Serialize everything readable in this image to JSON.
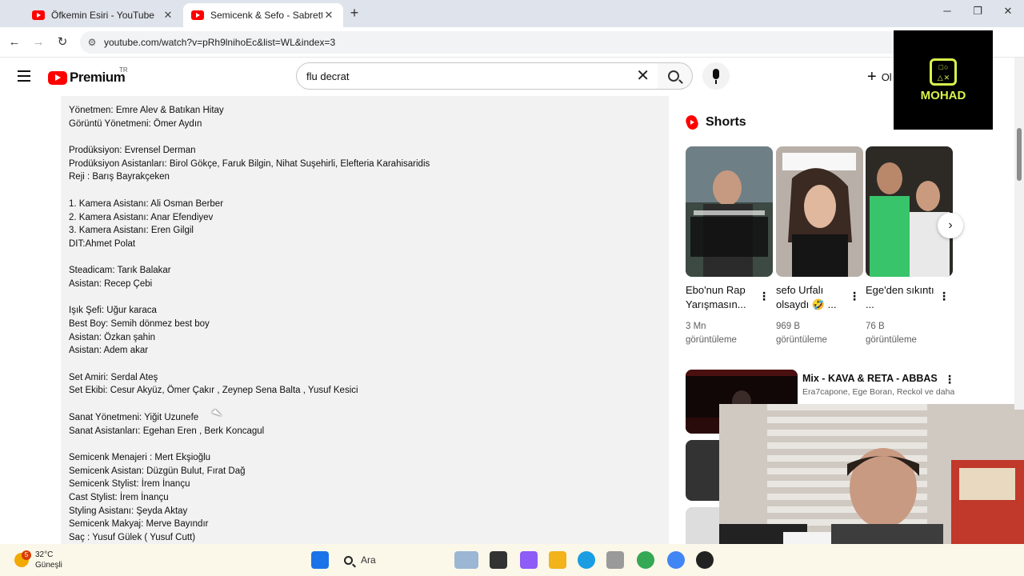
{
  "browser": {
    "tabs": [
      {
        "title": "Öfkemin Esiri - YouTube",
        "active": false
      },
      {
        "title": "Semicenk & Sefo - Sabrettim (p",
        "active": true
      }
    ],
    "url": "youtube.com/watch?v=pRh9lnihoEc&list=WL&index=3"
  },
  "youtube": {
    "logo_text": "Premium",
    "country": "TR",
    "search_value": "flu decrat",
    "create_label": "Ol"
  },
  "overlay": {
    "brand": "MOHAD"
  },
  "description_lines": [
    "Yönetmen: Emre Alev & Batıkan Hitay",
    "Görüntü Yönetmeni: Ömer Aydın",
    "",
    "Prodüksiyon: Evrensel Derman",
    "Prodüksiyon Asistanları: Birol Gökçe, Faruk Bilgin, Nihat Suşehirli, Elefteria Karahisaridis",
    "Reji : Barış Bayrakçeken",
    "",
    "1. Kamera Asistanı: Ali Osman Berber",
    "2. Kamera Asistanı: Anar Efendiyev",
    "3. Kamera Asistanı: Eren Gilgil",
    "DIT:Ahmet Polat",
    "",
    "Steadicam: Tarık Balakar",
    "Asistan: Recep Çebi",
    "",
    "Işık Şefi: Uğur karaca",
    "Best Boy: Semih dönmez best boy",
    "Asistan: Özkan şahin",
    "Asistan: Adem akar",
    "",
    "Set Amiri: Serdal Ateş",
    "Set Ekibi: Cesur Akyüz, Ömer Çakır , Zeynep Sena Balta , Yusuf Kesici",
    "",
    "Sanat Yönetmeni: Yiğit Uzunefe",
    "Sanat Asistanları: Egehan Eren , Berk Koncagul",
    "",
    "Semicenk Menajeri : Mert Ekşioğlu",
    "Semicenk Asistan: Düzgün Bulut, Fırat Dağ",
    "Semicenk Stylist: İrem İnançu",
    "Cast Stylist: İrem İnançu",
    "Styling Asistanı: Şeyda  Aktay",
    "Semicenk Makyaj: Merve Bayındır",
    "Saç : Yusuf Gülek ( Yusuf Cutt)"
  ],
  "shorts": {
    "heading": "Shorts",
    "items": [
      {
        "title": "Ebo'nun Rap Yarışmasın...",
        "views": "3 Mn",
        "views_label": "görüntüleme"
      },
      {
        "title": "sefo Urfalı olsaydı 🤣 ...",
        "views": "969 B",
        "views_label": "görüntüleme"
      },
      {
        "title": "Ege'den sıkıntı ...",
        "views": "76 B",
        "views_label": "görüntüleme"
      }
    ]
  },
  "mix": {
    "title": "Mix - KAVA & RETA - ABBAS",
    "subtitle": "Era7capone, Ege Boran, Reckol ve daha f..."
  },
  "taskbar": {
    "temperature": "32°C",
    "condition": "Güneşli",
    "badge": "5",
    "search_label": "Ara"
  },
  "colors": {
    "accent": "#ff0000",
    "overlay_accent": "#d9f24a"
  }
}
